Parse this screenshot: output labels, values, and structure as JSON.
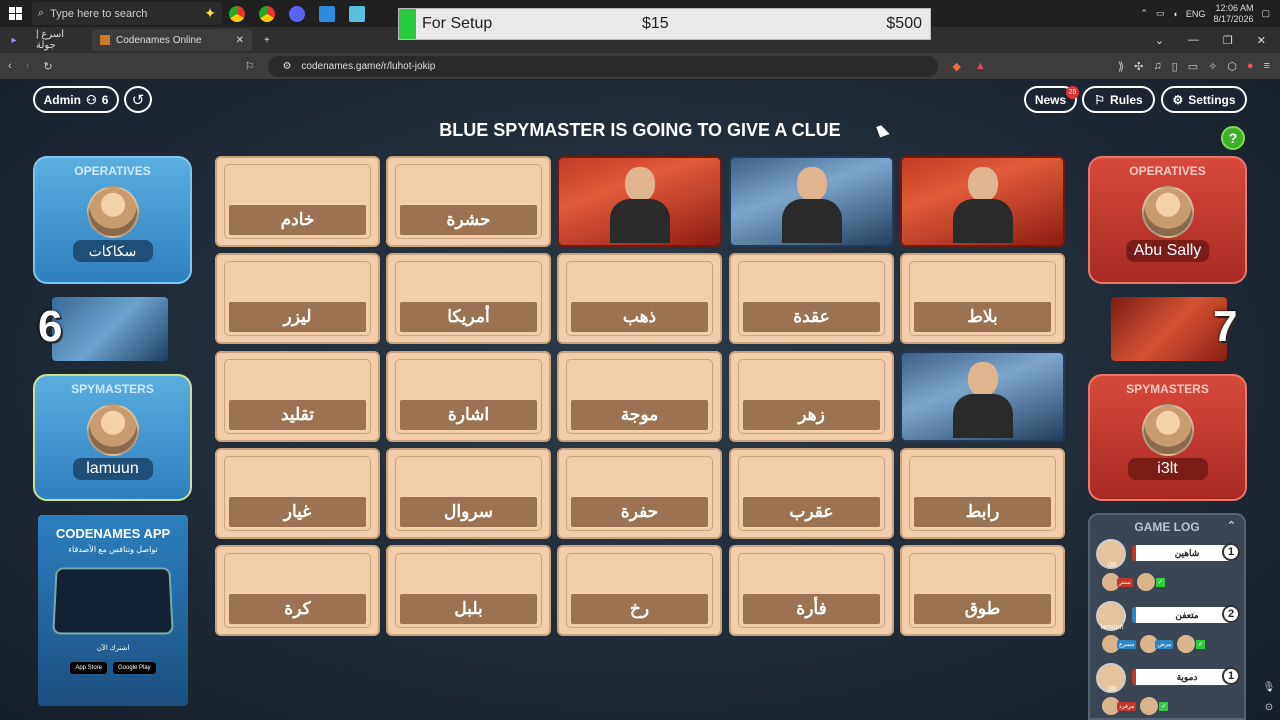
{
  "taskbar": {
    "search_placeholder": "Type here to search",
    "tray": {
      "language": "ENG",
      "time": "12:06 AM",
      "date": "8/17/2026"
    }
  },
  "overlay": {
    "label": "For Setup",
    "mid_value": "$15",
    "right_value": "$500"
  },
  "browser": {
    "tabs": [
      {
        "label": "اسرع | جولة"
      },
      {
        "label": "Codenames Online"
      }
    ],
    "url": "codenames.game/r/luhot-jokip"
  },
  "game": {
    "admin_label": "Admin",
    "player_count": "6",
    "news_label": "News",
    "news_badge": "25",
    "rules_label": "Rules",
    "settings_label": "Settings",
    "status_text": "BLUE SPYMASTER IS GOING TO GIVE A CLUE",
    "help_label": "?",
    "blue_team": {
      "operatives_label": "OPERATIVES",
      "operative_name": "سكاكات",
      "remaining": "6",
      "spymasters_label": "SPYMASTERS",
      "spymaster_name": "lamuun"
    },
    "red_team": {
      "operatives_label": "OPERATIVES",
      "operative_name": "Abu Sally",
      "remaining": "7",
      "spymasters_label": "SPYMASTERS",
      "spymaster_name": "i3lt"
    },
    "app_ad": {
      "title": "CODENAMES APP",
      "subtitle": "تواصل وتنافس مع الأصدقاء",
      "cta": "اشترك الآن",
      "store1": "App Store",
      "store2": "Google Play"
    },
    "cards": [
      {
        "type": "word",
        "word": "خادم"
      },
      {
        "type": "word",
        "word": "حشرة"
      },
      {
        "type": "agent",
        "team": "red"
      },
      {
        "type": "agent",
        "team": "blue"
      },
      {
        "type": "agent",
        "team": "red"
      },
      {
        "type": "word",
        "word": "ليزر"
      },
      {
        "type": "word",
        "word": "أمريكا"
      },
      {
        "type": "word",
        "word": "ذهب"
      },
      {
        "type": "word",
        "word": "عقدة"
      },
      {
        "type": "word",
        "word": "بلاط"
      },
      {
        "type": "word",
        "word": "تقليد"
      },
      {
        "type": "word",
        "word": "اشارة"
      },
      {
        "type": "word",
        "word": "موجة"
      },
      {
        "type": "word",
        "word": "زهر"
      },
      {
        "type": "agent",
        "team": "blue"
      },
      {
        "type": "word",
        "word": "غيار"
      },
      {
        "type": "word",
        "word": "سروال"
      },
      {
        "type": "word",
        "word": "حفرة"
      },
      {
        "type": "word",
        "word": "عقرب"
      },
      {
        "type": "word",
        "word": "رابط"
      },
      {
        "type": "word",
        "word": "كرة"
      },
      {
        "type": "word",
        "word": "بلبل"
      },
      {
        "type": "word",
        "word": "رخ"
      },
      {
        "type": "word",
        "word": "فأرة"
      },
      {
        "type": "word",
        "word": "طوق"
      }
    ],
    "game_log": {
      "title": "GAME LOG",
      "entries": [
        {
          "team": "red",
          "player": "i3lt",
          "clue": "شاهين",
          "number": "1",
          "guesses": [
            {
              "player": "Abu Sally",
              "word": "سنتر"
            },
            {
              "player": "Abu Sally",
              "word": ""
            }
          ]
        },
        {
          "team": "blue",
          "player": "lamuun",
          "clue": "متعفن",
          "number": "2",
          "guesses": [
            {
              "player": "",
              "word": "مسرع"
            },
            {
              "player": "",
              "word": "مرض"
            },
            {
              "player": "",
              "word": ""
            }
          ]
        },
        {
          "team": "red",
          "player": "i3lt",
          "clue": "دموية",
          "number": "1",
          "guesses": [
            {
              "player": "Abu Sally",
              "word": "مرفرد"
            },
            {
              "player": "Abu Sally",
              "word": ""
            }
          ]
        }
      ]
    }
  }
}
